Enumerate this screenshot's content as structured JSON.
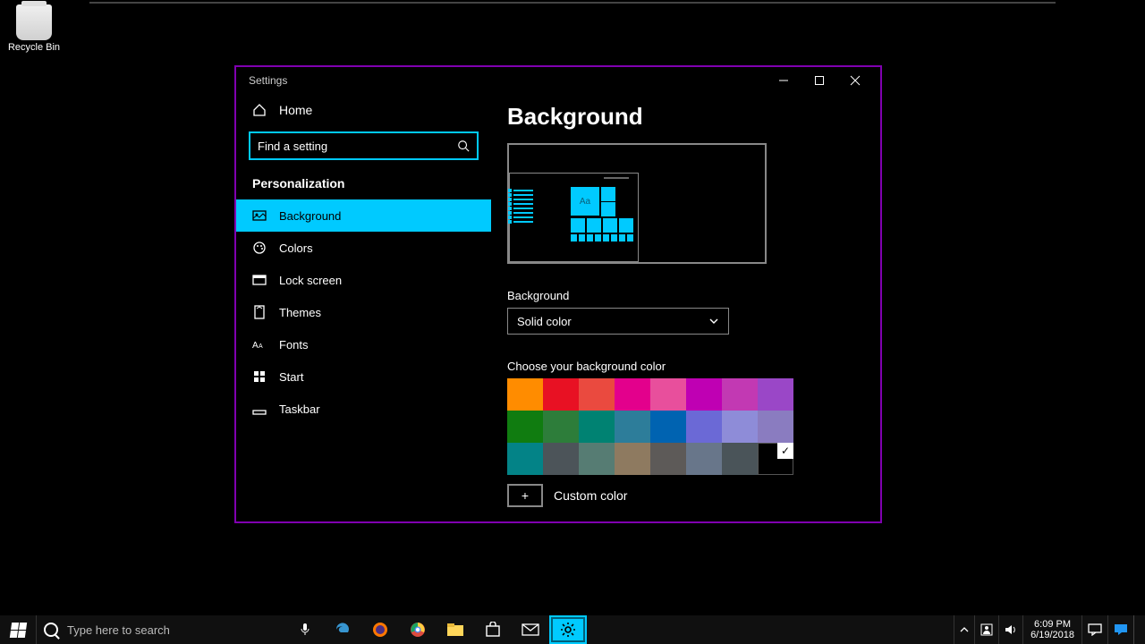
{
  "desktop": {
    "recycle_bin": "Recycle Bin"
  },
  "window": {
    "title": "Settings",
    "home": "Home",
    "search_placeholder": "Find a setting",
    "section": "Personalization",
    "nav": [
      {
        "label": "Background",
        "active": true
      },
      {
        "label": "Colors"
      },
      {
        "label": "Lock screen"
      },
      {
        "label": "Themes"
      },
      {
        "label": "Fonts"
      },
      {
        "label": "Start"
      },
      {
        "label": "Taskbar"
      }
    ]
  },
  "content": {
    "heading": "Background",
    "preview_sample": "Aa",
    "bg_label": "Background",
    "bg_value": "Solid color",
    "choose_label": "Choose your background color",
    "colors_row1": [
      "#ff8c00",
      "#e81123",
      "#ea4a3f",
      "#e3008c",
      "#e84f9c",
      "#bf00b3",
      "#c239b3",
      "#9a47c7"
    ],
    "colors_row2": [
      "#107c10",
      "#2d7d3a",
      "#008272",
      "#2d7d9a",
      "#0063b1",
      "#6b69d6",
      "#8e8cd8",
      "#8a7cc0"
    ],
    "colors_row3": [
      "#038387",
      "#4c5459",
      "#567c73",
      "#8e7a60",
      "#5d5a58",
      "#68768a",
      "#4a5459",
      "#000000"
    ],
    "selected_color": "#000000",
    "custom_label": "Custom color",
    "custom_plus": "+"
  },
  "taskbar": {
    "search_placeholder": "Type here to search",
    "time": "6:09 PM",
    "date": "6/19/2018"
  }
}
